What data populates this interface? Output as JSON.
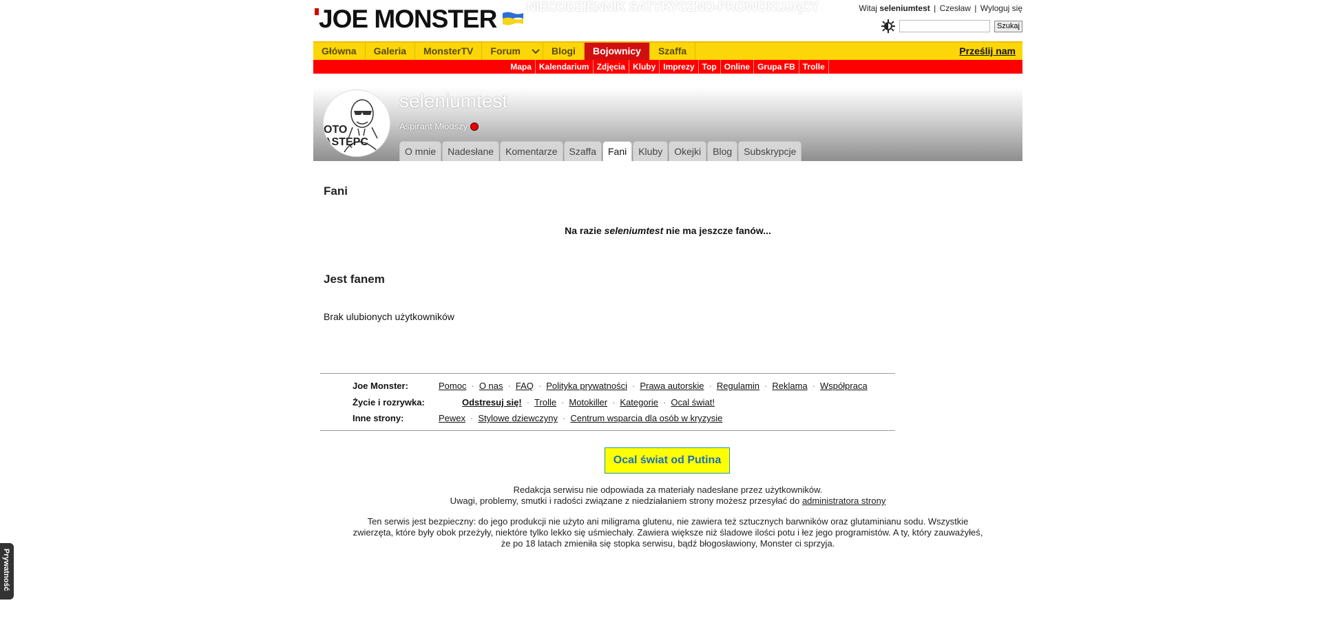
{
  "header": {
    "logo_text": "JOE MONSTER",
    "slogan": "NIECODZIENNIK SATYRYCZNO-PROWOKUJĄCY",
    "welcome": "Witaj",
    "username": "seleniumtest",
    "link_czeslaw": "Czesław",
    "logout": "Wyloguj się",
    "search_placeholder": "",
    "search_button": "Szukaj"
  },
  "main_nav": {
    "items": [
      "Główna",
      "Galeria",
      "MonsterTV",
      "Forum",
      "Blogi",
      "Bojownicy",
      "Szaffa"
    ],
    "active": "Bojownicy",
    "submit": "Prześlij nam"
  },
  "sub_nav": {
    "items": [
      "Mapa",
      "Kalendarium",
      "Zdjęcia",
      "Kluby",
      "Imprezy",
      "Top",
      "Online",
      "Grupa FB",
      "Trolle"
    ]
  },
  "profile": {
    "username": "seleniumtest",
    "rank": "Aspirant Młodszy",
    "avatar_text_1": "OTO",
    "avatar_text_2": "ASTĘPC",
    "tabs": [
      "O mnie",
      "Nadesłane",
      "Komentarze",
      "Szaffa",
      "Fani",
      "Kluby",
      "Okejki",
      "Blog",
      "Subskrypcje"
    ],
    "active_tab": "Fani"
  },
  "fans": {
    "heading": "Fani",
    "message_before": "Na razie ",
    "message_user": "seleniumtest",
    "message_after": " nie ma jeszcze fanów..."
  },
  "is_fan": {
    "heading": "Jest fanem",
    "message": "Brak ulubionych użytkowników"
  },
  "footer": {
    "rows": [
      {
        "label": "Joe Monster:",
        "links": [
          "Pomoc",
          "O nas",
          "FAQ",
          "Polityka prywatności",
          "Prawa autorskie",
          "Regulamin",
          "Reklama",
          "Współpraca"
        ]
      },
      {
        "label": "Życie i rozrywka:",
        "links": [
          "Odstresuj się!",
          "Trolle",
          "Motokiller",
          "Kategorie",
          "Ocal świat!"
        ]
      },
      {
        "label": "Inne strony:",
        "links": [
          "Pewex",
          "Stylowe dziewczyny",
          "Centrum wsparcia dla osób w kryzysie"
        ]
      }
    ],
    "putin_button": "Ocal świat od Putina",
    "disclaimer_1": "Redakcja serwisu nie odpowiada za materiały nadesłane przez użytkowników.",
    "disclaimer_2": "Uwagi, problemy, smutki i radości związane z niedziałaniem strony możesz przesyłać do ",
    "admin_link": "administratora strony",
    "safe_text_1": "Ten serwis jest bezpieczny: do jego produkcji nie użyto ani miligrama glutenu, nie zawiera też sztucznych barwników oraz glutaminianu sodu. Wszystkie",
    "safe_text_2": "zwierzęta, które były obok przeżyły, niektóre tylko lekko się uśmiechały. Zawiera większe niż śladowe ilości potu i łez jego programistów. A ty, który zauważyłeś,",
    "safe_text_3": "że po 18 latach zmieniła się stopka serwisu, bądź błogosławiony, Monster ci sprzyja.",
    "privacy": "Prywatność"
  },
  "colors": {
    "nav_yellow": "#fcd608",
    "nav_red": "#ff0000",
    "active_red": "#d10f0f",
    "button_yellow": "#ffff00",
    "button_text": "#1a6fbf"
  }
}
